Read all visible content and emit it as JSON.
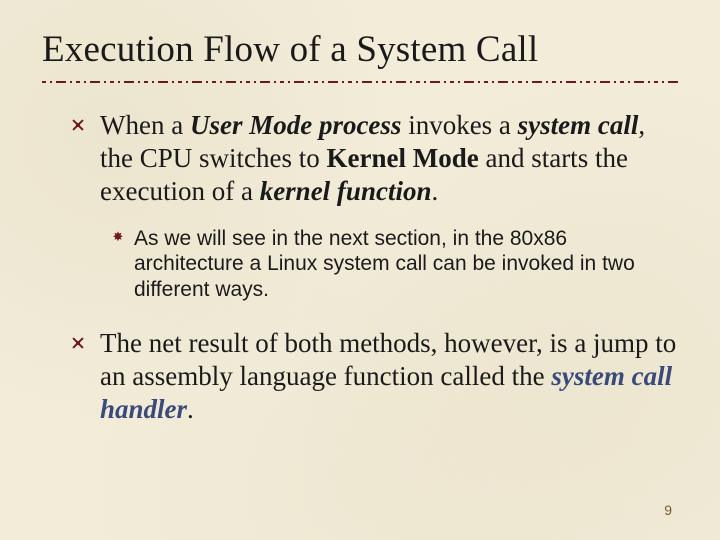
{
  "title": "Execution Flow of a System Call",
  "bullets": [
    {
      "level": 1,
      "runs": [
        {
          "t": "When a ",
          "cls": ""
        },
        {
          "t": "User Mode process",
          "cls": "bi"
        },
        {
          "t": " invokes a ",
          "cls": ""
        },
        {
          "t": "system call",
          "cls": "bi"
        },
        {
          "t": ", the CPU switches to ",
          "cls": ""
        },
        {
          "t": "Kernel Mode",
          "cls": "b"
        },
        {
          "t": " and starts the execution of a ",
          "cls": ""
        },
        {
          "t": "kernel function",
          "cls": "bi"
        },
        {
          "t": ".",
          "cls": ""
        }
      ]
    },
    {
      "level": 2,
      "runs": [
        {
          "t": "As we will see in the next section, in the 80x86 architecture a Linux system call can be invoked in two different ways.",
          "cls": ""
        }
      ]
    },
    {
      "level": 1,
      "runs": [
        {
          "t": "The net result of both methods, however, is a jump to an assembly language function called the ",
          "cls": ""
        },
        {
          "t": "system call handler",
          "cls": "em-color"
        },
        {
          "t": ".",
          "cls": ""
        }
      ]
    }
  ],
  "page_number": "9"
}
